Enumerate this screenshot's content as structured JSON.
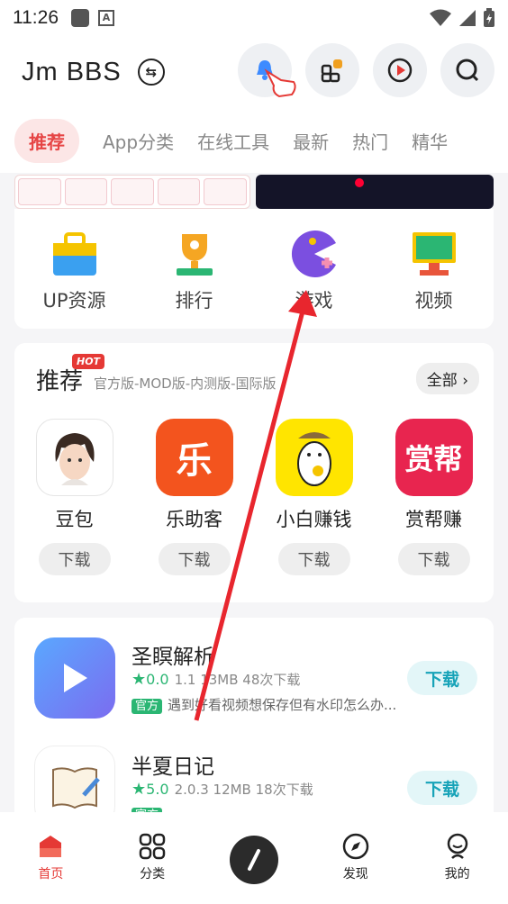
{
  "status": {
    "time": "11:26"
  },
  "header": {
    "title": "Jm BBS"
  },
  "tabs": [
    {
      "label": "推荐"
    },
    {
      "label": "App分类"
    },
    {
      "label": "在线工具"
    },
    {
      "label": "最新"
    },
    {
      "label": "热门"
    },
    {
      "label": "精华"
    }
  ],
  "categories": [
    {
      "label": "UP资源",
      "icon": "toolbox-icon"
    },
    {
      "label": "排行",
      "icon": "trophy-icon"
    },
    {
      "label": "游戏",
      "icon": "pacman-icon"
    },
    {
      "label": "视频",
      "icon": "monitor-icon"
    }
  ],
  "recommend": {
    "title": "推荐",
    "hot_badge": "HOT",
    "subtitle": "官方版-MOD版-内测版-国际版",
    "all_label": "全部 ›",
    "apps": [
      {
        "name": "豆包",
        "download": "下载",
        "icon_text": ""
      },
      {
        "name": "乐助客",
        "download": "下载",
        "icon_text": "乐"
      },
      {
        "name": "小白赚钱",
        "download": "下载",
        "icon_text": ""
      },
      {
        "name": "赏帮赚",
        "download": "下载",
        "icon_text": "赏帮"
      }
    ]
  },
  "list": [
    {
      "name": "圣瞑解析",
      "rating": "0.0",
      "meta": "1.1 13MB 48次下载",
      "badge": "官方",
      "desc": "遇到好看视频想保存但有水印怎么办...",
      "button": "下载"
    },
    {
      "name": "半夏日记",
      "rating": "5.0",
      "meta": "2.0.3 12MB 18次下载",
      "badge": "官方",
      "desc": "",
      "button": "下载"
    }
  ],
  "tabbar": [
    {
      "label": "首页"
    },
    {
      "label": "分类"
    },
    {
      "label": ""
    },
    {
      "label": "发现"
    },
    {
      "label": "我的"
    }
  ],
  "colors": {
    "accent": "#e53935",
    "green": "#2bb673",
    "teal": "#17a3b8"
  }
}
